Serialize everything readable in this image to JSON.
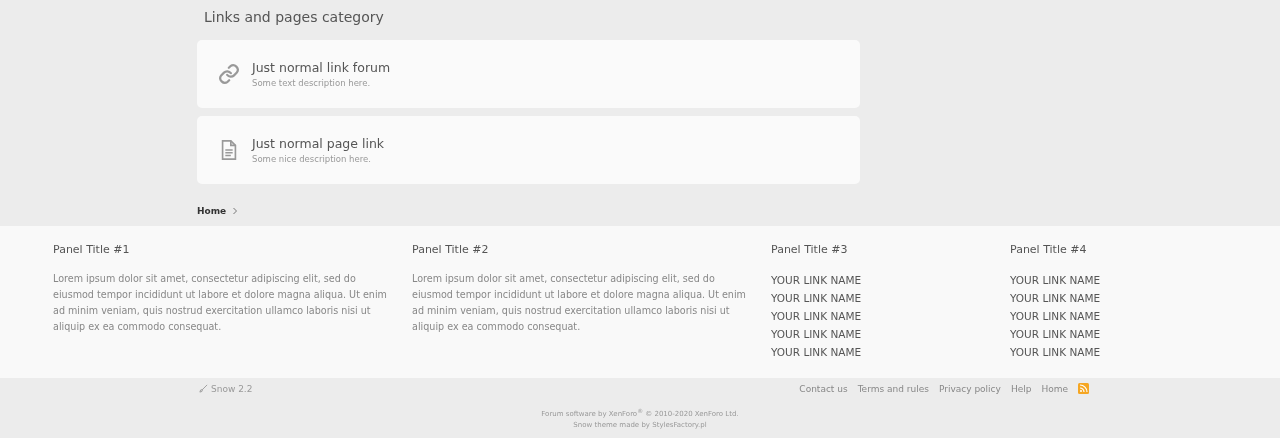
{
  "category": {
    "title": "Links and pages category"
  },
  "nodes": [
    {
      "kind": "link",
      "title": "Just normal link forum",
      "description": "Some text description here."
    },
    {
      "kind": "page",
      "title": "Just normal page link",
      "description": "Some nice description here."
    }
  ],
  "breadcrumb": [
    {
      "label": "Home"
    }
  ],
  "panels": [
    {
      "title": "Panel Title #1",
      "kind": "text",
      "text": "Lorem ipsum dolor sit amet, consectetur adipiscing elit, sed do eiusmod tempor incididunt ut labore et dolore magna aliqua. Ut enim ad minim veniam, quis nostrud exercitation ullamco laboris nisi ut aliquip ex ea commodo consequat."
    },
    {
      "title": "Panel Title #2",
      "kind": "text",
      "text": "Lorem ipsum dolor sit amet, consectetur adipiscing elit, sed do eiusmod tempor incididunt ut labore et dolore magna aliqua. Ut enim ad minim veniam, quis nostrud exercitation ullamco laboris nisi ut aliquip ex ea commodo consequat."
    },
    {
      "title": "Panel Title #3",
      "kind": "links",
      "links": [
        "YOUR LINK NAME",
        "YOUR LINK NAME",
        "YOUR LINK NAME",
        "YOUR LINK NAME",
        "YOUR LINK NAME"
      ]
    },
    {
      "title": "Panel Title #4",
      "kind": "links",
      "links": [
        "YOUR LINK NAME",
        "YOUR LINK NAME",
        "YOUR LINK NAME",
        "YOUR LINK NAME",
        "YOUR LINK NAME"
      ]
    }
  ],
  "footer": {
    "style_name": "Snow 2.2",
    "links": [
      "Contact us",
      "Terms and rules",
      "Privacy policy",
      "Help",
      "Home"
    ],
    "copyright": "Forum software by XenForo$^{®}$ © 2010-2020 XenForo Ltd.",
    "theme_credit": "Snow theme made by StylesFactory.pl"
  }
}
